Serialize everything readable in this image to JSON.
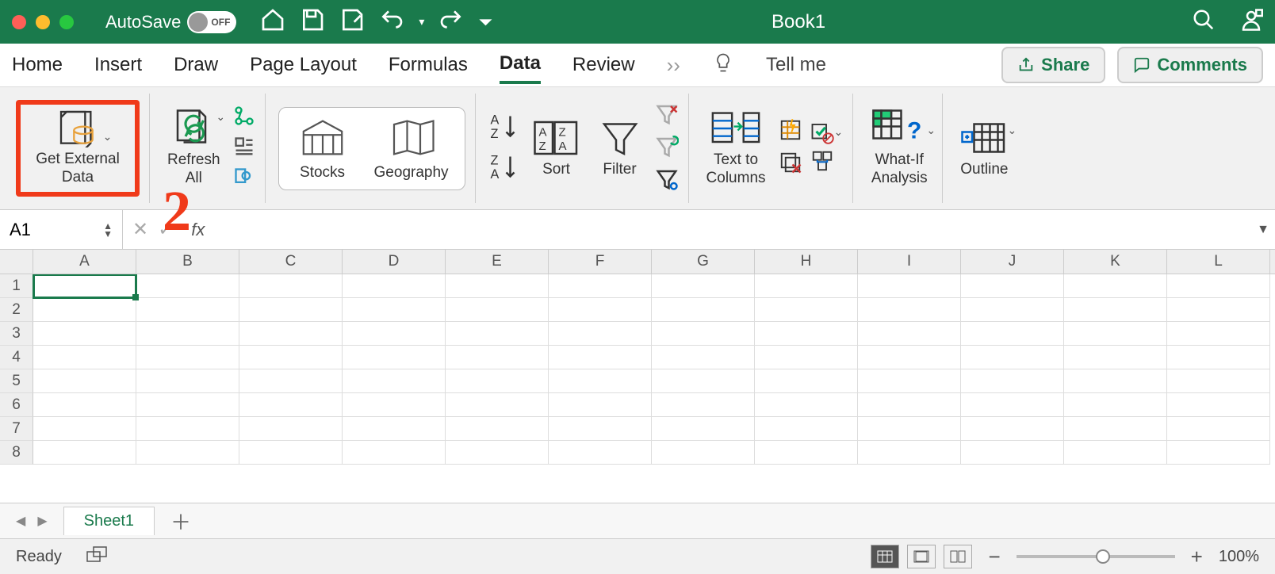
{
  "titlebar": {
    "autosave_label": "AutoSave",
    "autosave_state": "OFF",
    "document_title": "Book1"
  },
  "tabs": {
    "items": [
      "Home",
      "Insert",
      "Draw",
      "Page Layout",
      "Formulas",
      "Data",
      "Review"
    ],
    "active_index": 5,
    "tell_me": "Tell me",
    "share": "Share",
    "comments": "Comments"
  },
  "ribbon": {
    "get_external_data": "Get External\nData",
    "refresh_all": "Refresh\nAll",
    "stocks": "Stocks",
    "geography": "Geography",
    "sort": "Sort",
    "filter": "Filter",
    "text_to_columns": "Text to\nColumns",
    "what_if": "What-If\nAnalysis",
    "outline": "Outline"
  },
  "callout": {
    "number": "2"
  },
  "formula_bar": {
    "name_box": "A1",
    "fx": "fx",
    "value": ""
  },
  "grid": {
    "columns": [
      "A",
      "B",
      "C",
      "D",
      "E",
      "F",
      "G",
      "H",
      "I",
      "J",
      "K",
      "L"
    ],
    "rows": [
      "1",
      "2",
      "3",
      "4",
      "5",
      "6",
      "7",
      "8"
    ],
    "selected": "A1"
  },
  "sheettabs": {
    "tabs": [
      "Sheet1"
    ]
  },
  "statusbar": {
    "status": "Ready",
    "zoom": "100%"
  }
}
